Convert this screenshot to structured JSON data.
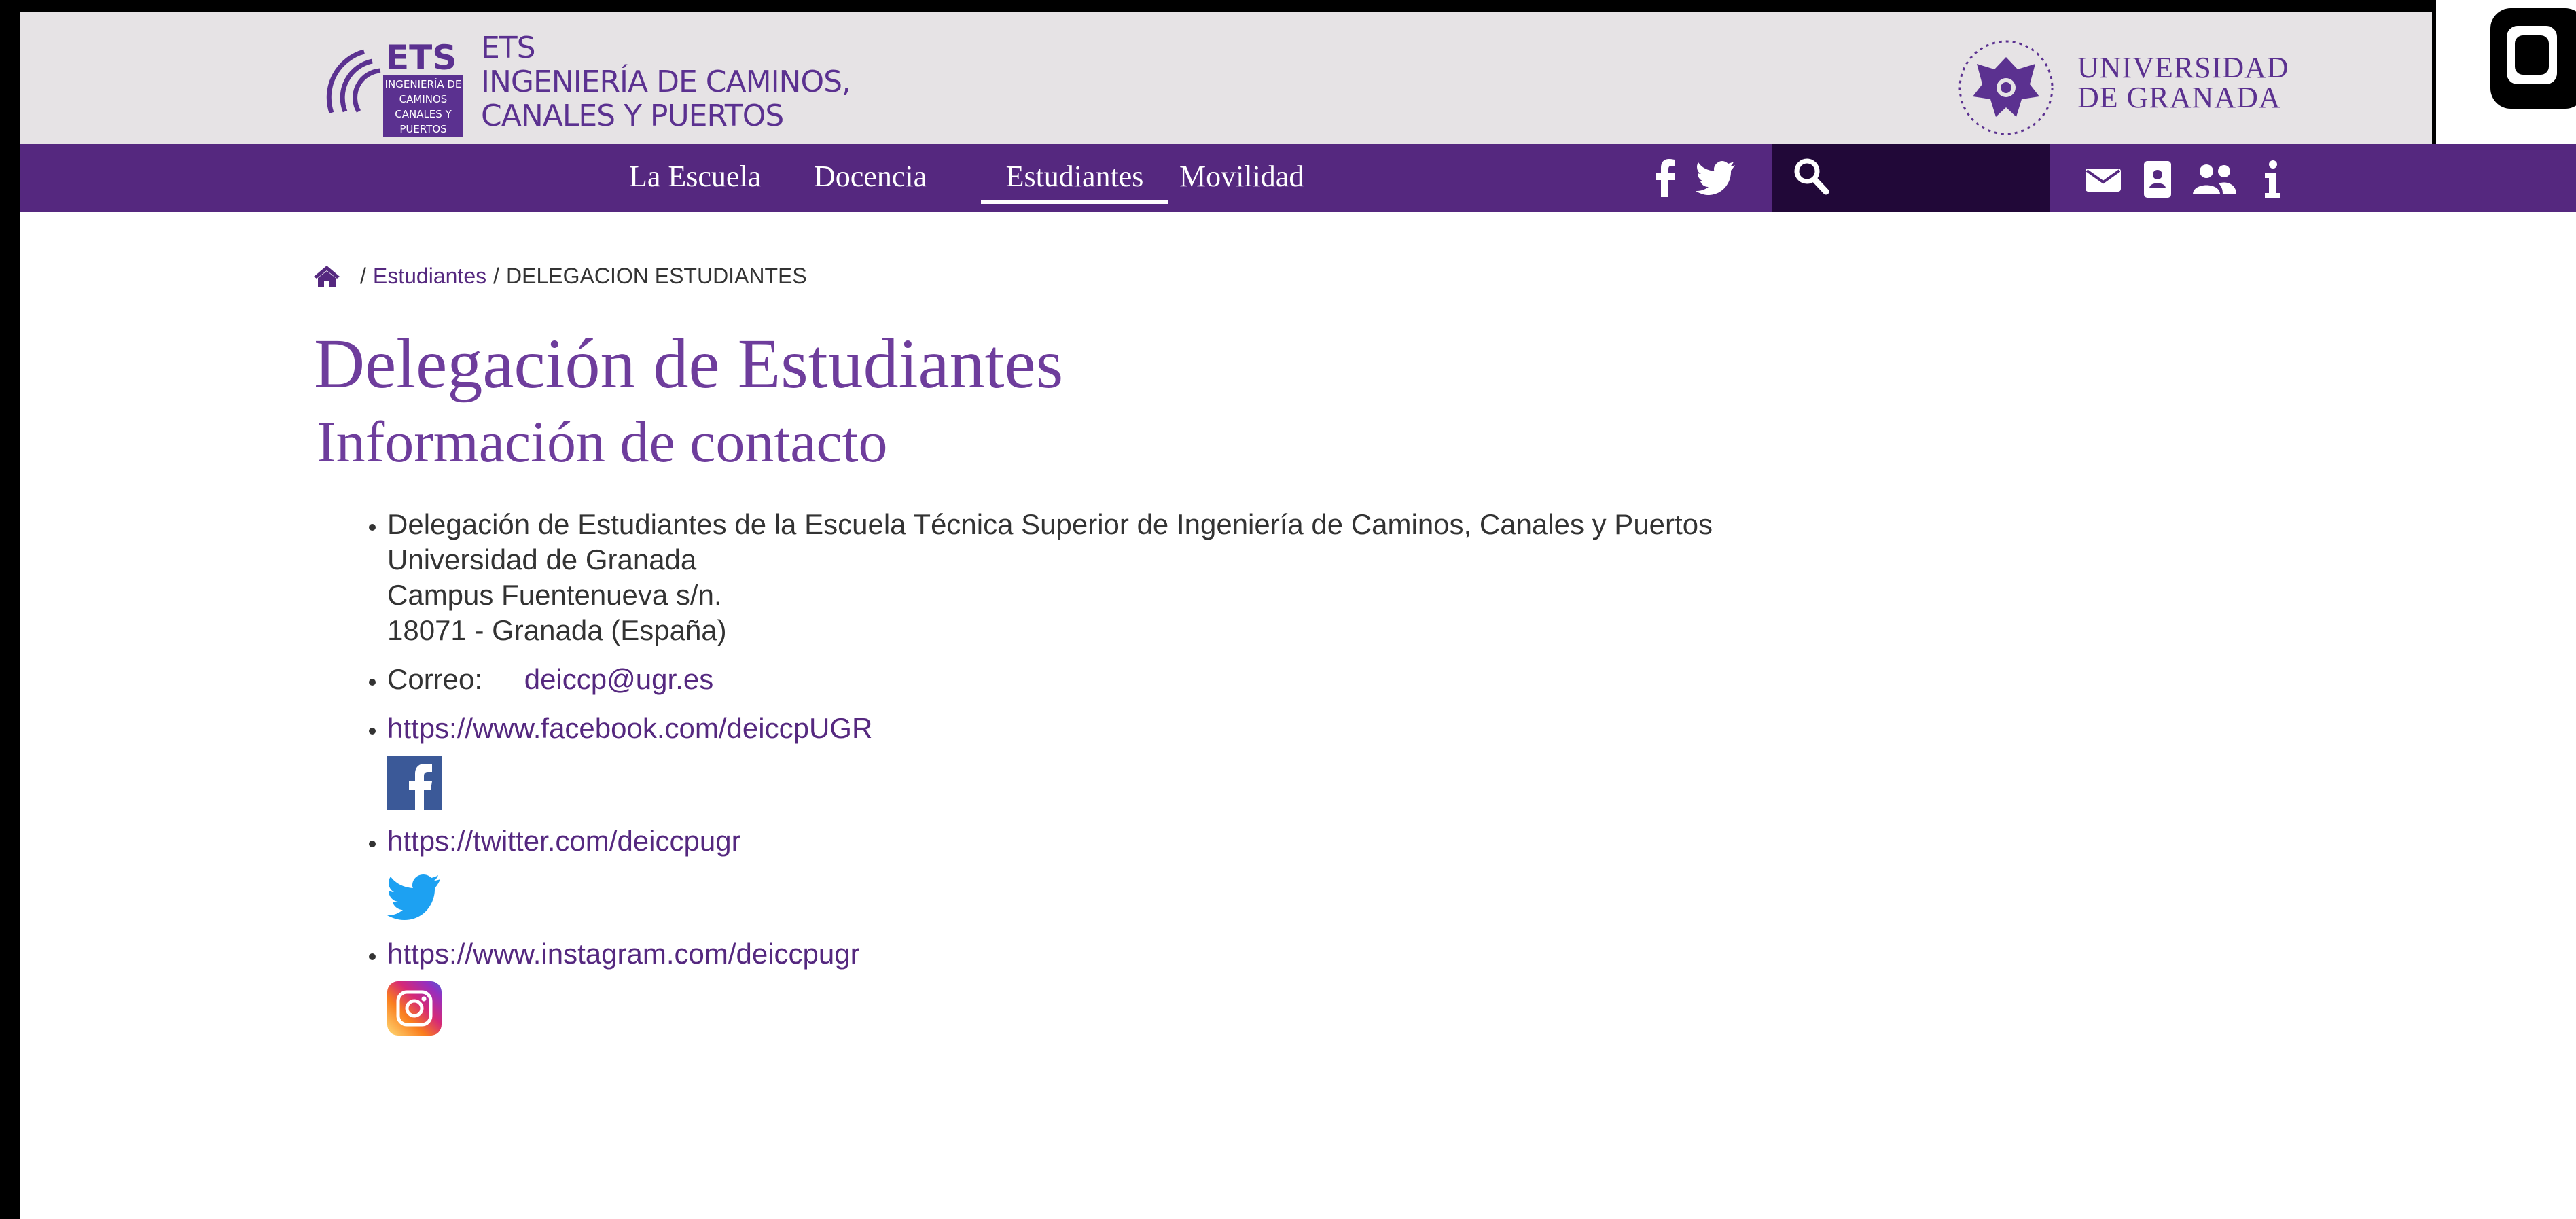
{
  "header": {
    "ets_logo_text": "ETS",
    "ets_logo_sub": [
      "INGENIERÍA DE",
      "CAMINOS",
      "CANALES Y",
      "PUERTOS"
    ],
    "school_name_lines": [
      "ETS",
      "INGENIERÍA DE CAMINOS,",
      "CANALES Y PUERTOS"
    ],
    "university_lines": [
      "UNIVERSIDAD",
      "DE GRANADA"
    ]
  },
  "nav": {
    "items": [
      {
        "label": "La Escuela",
        "active": false
      },
      {
        "label": "Docencia",
        "active": false
      },
      {
        "label": "Estudiantes",
        "active": true
      },
      {
        "label": "Movilidad",
        "active": false
      }
    ],
    "social_icons": [
      "facebook-icon",
      "twitter-icon"
    ],
    "search_icon": "search-icon",
    "utility_icons": [
      "envelope-icon",
      "address-book-icon",
      "users-icon",
      "info-icon"
    ]
  },
  "breadcrumb": {
    "home_icon": "home-icon",
    "separator": "/",
    "link": "Estudiantes",
    "current": "DELEGACION ESTUDIANTES"
  },
  "page": {
    "title": "Delegación de Estudiantes",
    "subtitle": "Información de contacto"
  },
  "contact": {
    "address_lines": [
      "Delegación de Estudiantes de la Escuela Técnica Superior de Ingeniería de Caminos, Canales y Puertos",
      "Universidad de Granada",
      "Campus Fuentenueva s/n.",
      "18071 - Granada (España)"
    ],
    "correo_label": "Correo:",
    "correo_email": "deiccp@ugr.es",
    "facebook_url": "https://www.facebook.com/deiccpUGR",
    "twitter_url": "https://twitter.com/deiccpugr",
    "instagram_url": "https://www.instagram.com/deiccpugr"
  },
  "colors": {
    "brand_purple": "#55287f",
    "title_purple": "#6e3d9c",
    "header_bg": "#e6e3e5",
    "search_bg": "#210838"
  }
}
